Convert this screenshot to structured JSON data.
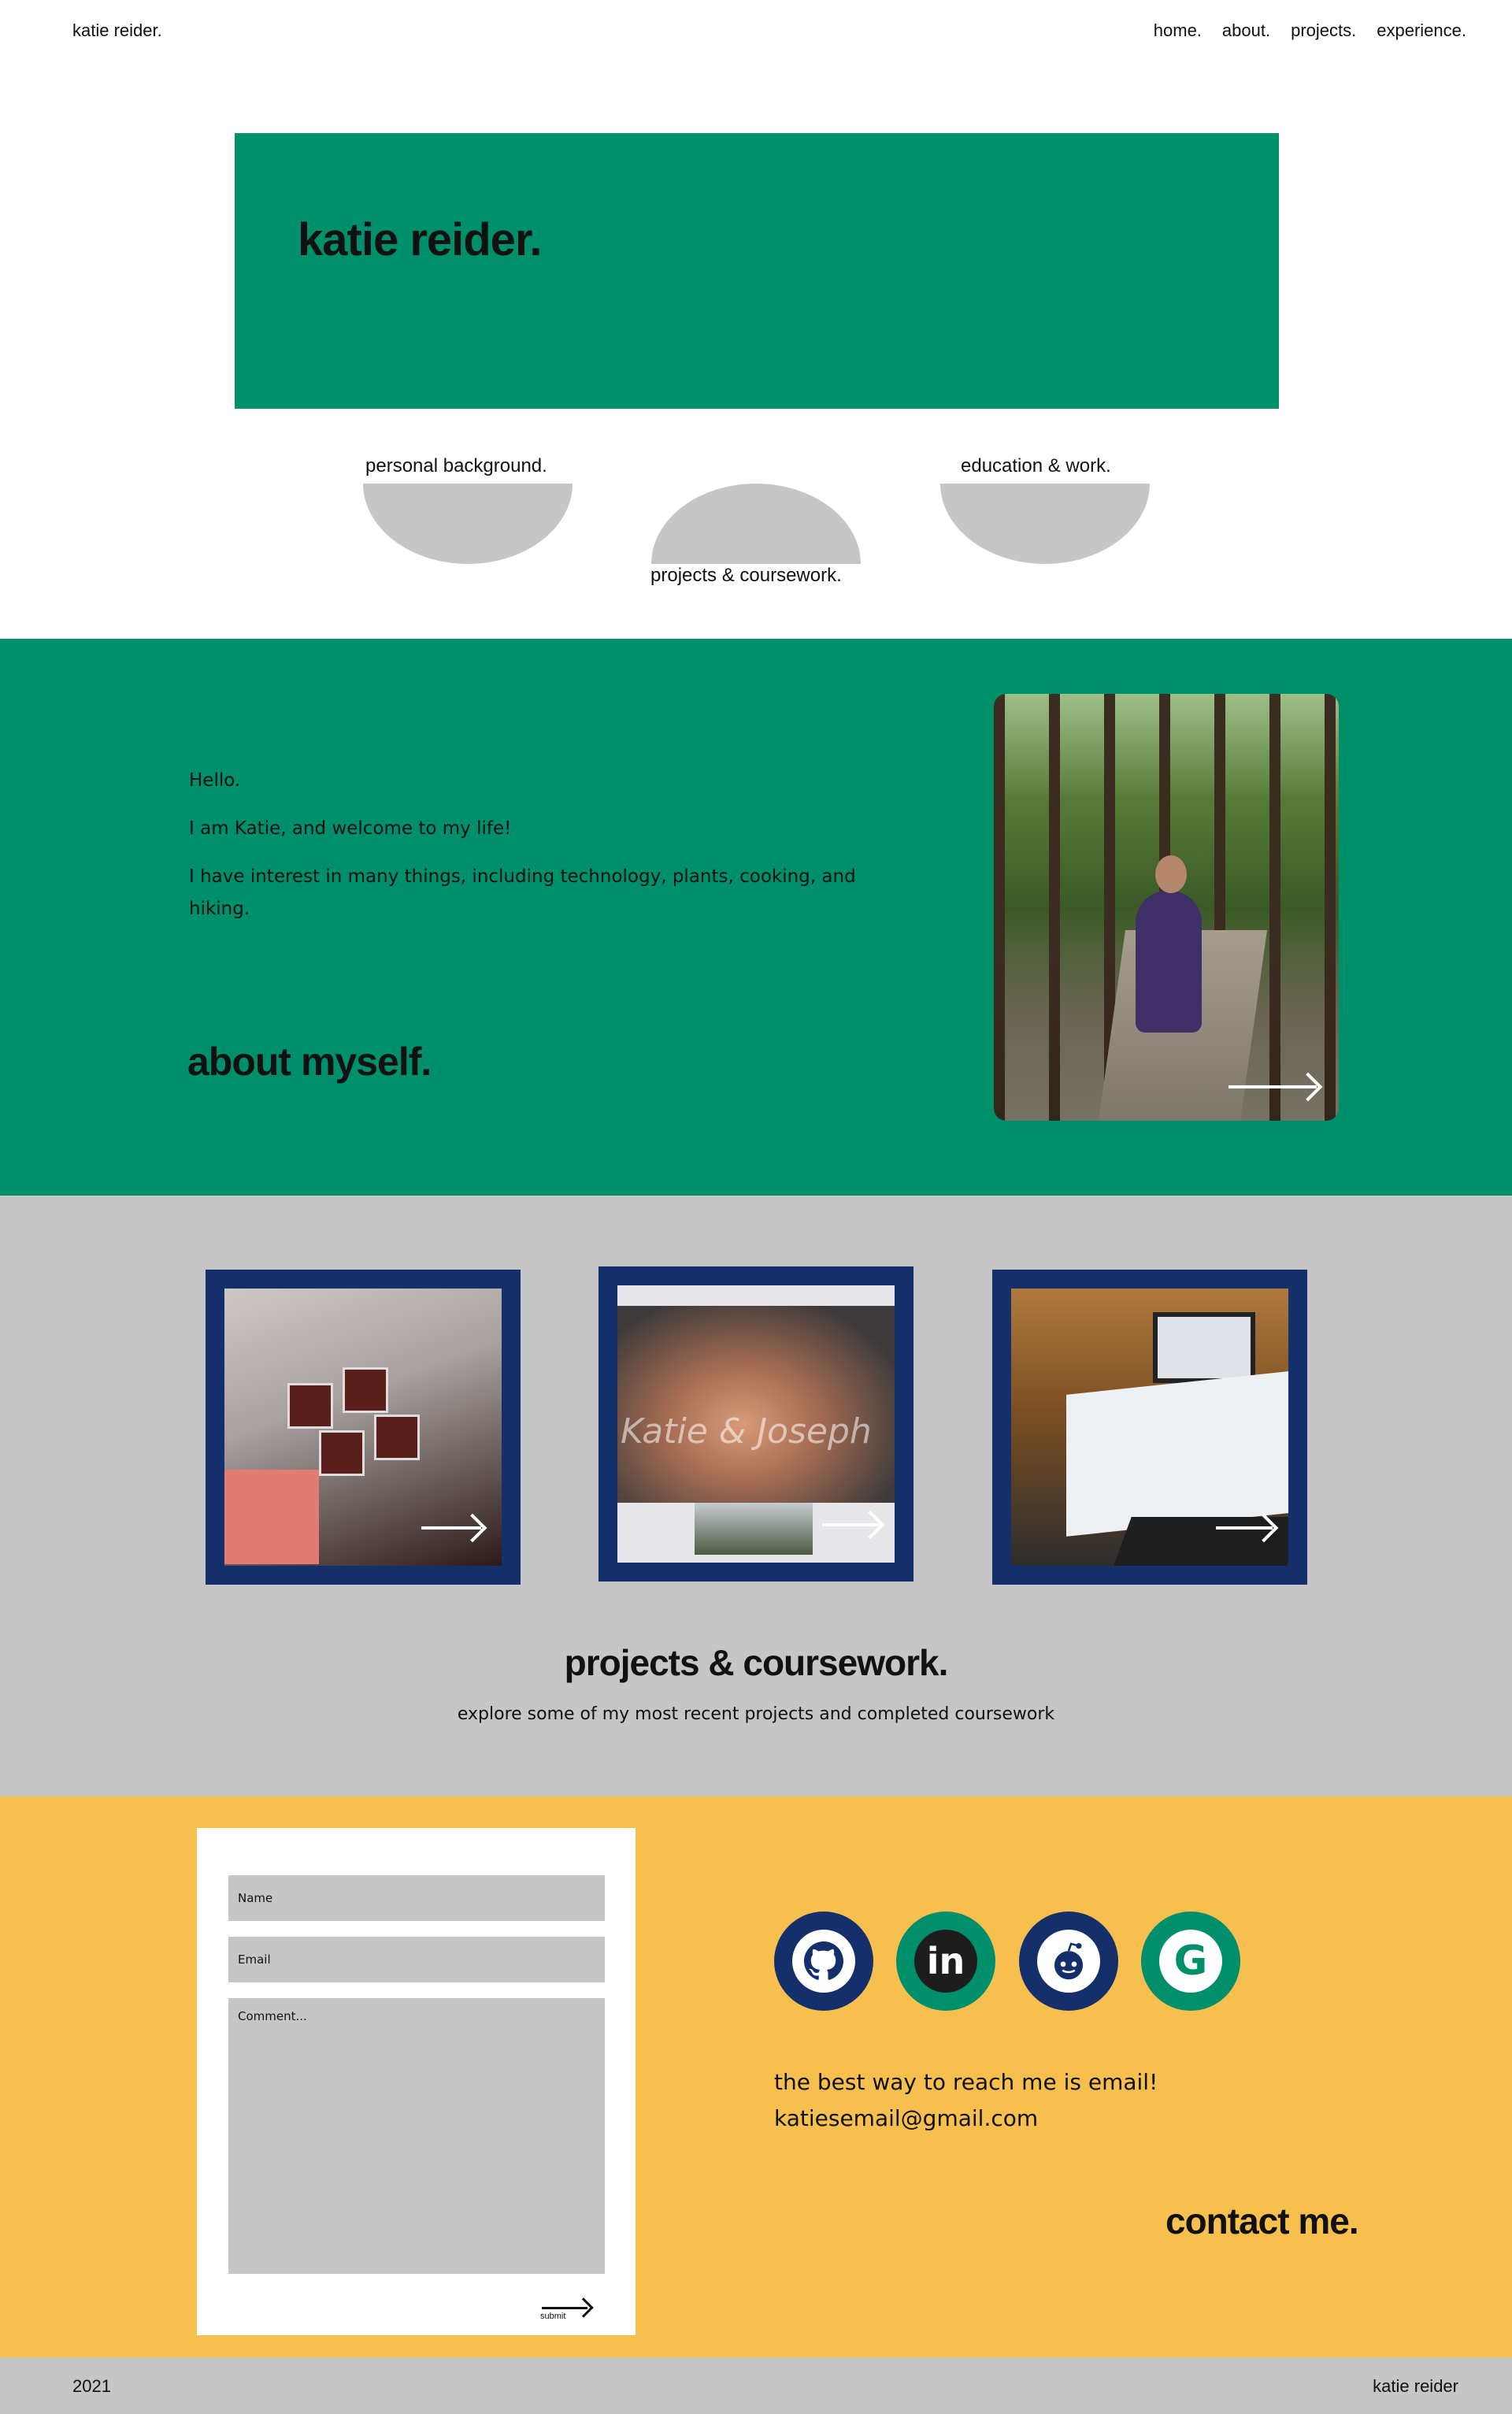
{
  "nav": {
    "brand": "katie reider.",
    "links": [
      "home.",
      "about.",
      "projects.",
      "experience."
    ]
  },
  "hero": {
    "title": "katie reider.",
    "sections": {
      "personal": "personal background.",
      "projects": "projects & coursework.",
      "education": "education & work."
    }
  },
  "about": {
    "paragraphs": [
      "Hello.",
      "I am Katie, and welcome to my life!",
      "I have interest in many things, including technology, plants, cooking, and hiking."
    ],
    "heading": "about myself."
  },
  "projects": {
    "card2_caption": "Katie & Joseph",
    "title": "projects & coursework.",
    "subtitle": "explore some of my most recent projects and completed coursework"
  },
  "contact": {
    "form": {
      "name_placeholder": "Name",
      "email_placeholder": "Email",
      "comment_placeholder": "Comment...",
      "submit_label": "submit"
    },
    "note_line1": "the best way to reach me is email!",
    "note_line2": "katiesemail@gmail.com",
    "heading": "contact me."
  },
  "footer": {
    "year": "2021",
    "name": "katie reider"
  },
  "colors": {
    "green": "#008f6b",
    "navy": "#142f6a",
    "yellow": "#f7bf4e",
    "gray": "#c6c6c6"
  }
}
